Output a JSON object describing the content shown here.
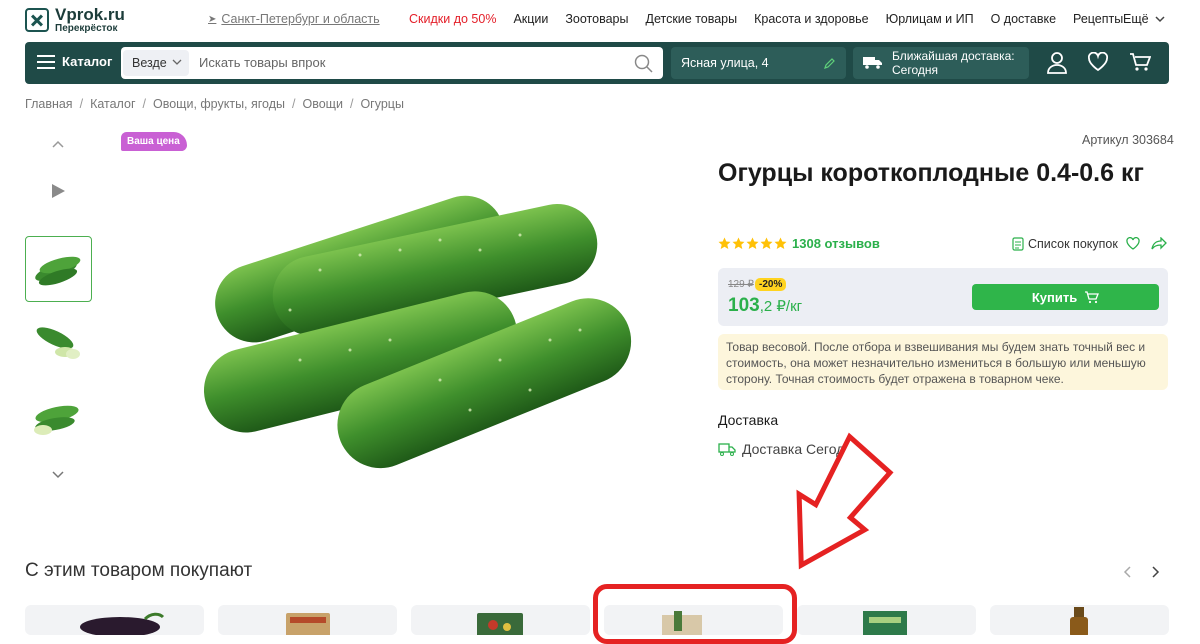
{
  "header": {
    "logo_title": "Vprok.ru",
    "logo_subtitle": "Перекрёсток",
    "region": "Санкт-Петербург и область",
    "nav": [
      "Скидки до 50%",
      "Акции",
      "Зоотовары",
      "Детские товары",
      "Красота и здоровье",
      "Юрлицам и ИП",
      "О доставке",
      "Рецепты"
    ],
    "more": "Ещё"
  },
  "navbar": {
    "catalog_label": "Каталог",
    "search_scope": "Везде",
    "search_placeholder": "Искать товары впрок",
    "address": "Ясная улица, 4",
    "delivery_line1": "Ближайшая доставка:",
    "delivery_line2": "Сегодня"
  },
  "breadcrumb": [
    "Главная",
    "Каталог",
    "Овощи, фрукты, ягоды",
    "Овощи",
    "Огурцы"
  ],
  "product": {
    "badge": "Ваша цена",
    "article": "Артикул 303684",
    "title": "Огурцы короткоплодные 0.4-0.6 кг",
    "rating_stars": 5,
    "reviews": "1308 отзывов",
    "shopping_list": "Список покупок",
    "old_price": "129 ₽",
    "discount": "-20%",
    "price_int": "103",
    "price_frac": ",2 ₽/кг",
    "buy_label": "Купить",
    "notice": "Товар весовой. После отбора и взвешивания мы будем знать точный вес и стоимость, она может незначительно измениться в большую или меньшую сторону. Точная стоимость будет отражена в товарном чеке.",
    "delivery_title": "Доставка",
    "delivery_text": "Доставка Сегодня"
  },
  "related": {
    "title": "С этим товаром покупают"
  },
  "colors": {
    "brand_dark": "#1f4a47",
    "accent_green": "#2fb54a",
    "sale_red": "#e4202a",
    "annotation_red": "#e52222"
  }
}
